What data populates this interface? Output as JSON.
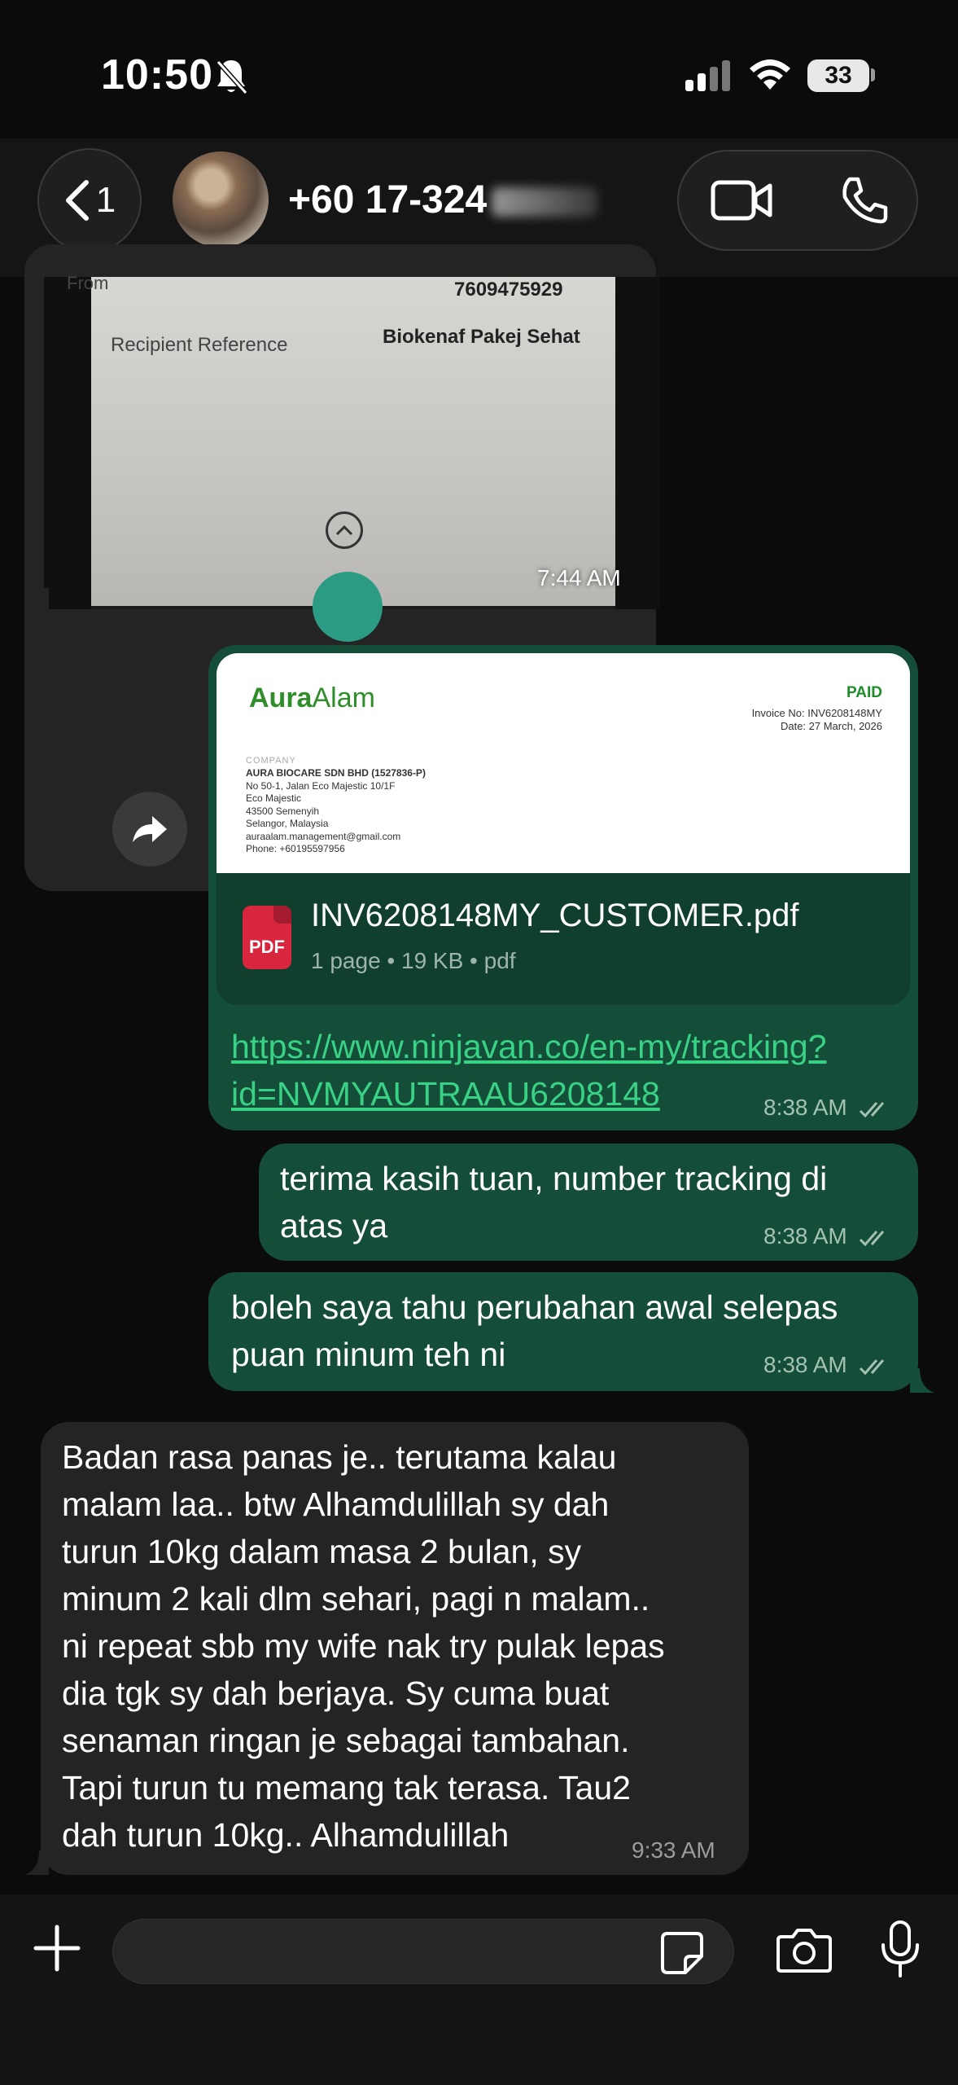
{
  "status_bar": {
    "time": "10:50",
    "battery": "33"
  },
  "header": {
    "back_count": "1",
    "contact_name": "+60 17-324"
  },
  "messages": {
    "image": {
      "photo_from_label": "From",
      "photo_number": "7609475929",
      "photo_ref_label": "Recipient Reference",
      "photo_ref_value": "Biokenaf Pakej Sehat",
      "time": "7:44 AM"
    },
    "invoice": {
      "logo_bold": "Aura",
      "logo_light": "Alam",
      "paid": "PAID",
      "invoice_no": "Invoice No: INV6208148MY",
      "date": "Date: 27 March, 2026",
      "company_label": "COMPANY",
      "company_lines": [
        "AURA BIOCARE SDN BHD (1527836-P)",
        "No 50-1, Jalan Eco Majestic 10/1F",
        "Eco Majestic",
        "43500 Semenyih",
        "Selangor, Malaysia",
        "auraalam.management@gmail.com",
        "Phone: +60195597956"
      ],
      "file_icon_label": "PDF",
      "file_name": "INV6208148MY_CUSTOMER.pdf",
      "file_meta": "1 page • 19 KB • pdf",
      "link_line1": "https://www.ninjavan.co/en-my/tracking?",
      "link_line2": "id=NVMYAUTRAAU6208148",
      "time": "8:38 AM"
    },
    "out1": {
      "line1": "terima kasih tuan, number tracking di",
      "line2": "atas ya",
      "time": "8:38 AM"
    },
    "out2": {
      "line1": "boleh saya tahu perubahan awal selepas",
      "line2": "puan minum teh ni",
      "time": "8:38 AM"
    },
    "in1": {
      "lines": [
        "Badan rasa panas je.. terutama kalau",
        "malam laa.. btw Alhamdulillah sy dah",
        "turun 10kg dalam masa 2 bulan, sy",
        "minum 2 kali dlm sehari, pagi n malam..",
        "ni repeat sbb my wife nak try pulak lepas",
        "dia tgk sy dah berjaya. Sy cuma buat",
        "senaman ringan je sebagai tambahan.",
        "Tapi turun tu memang tak terasa. Tau2",
        "dah turun 10kg.. Alhamdulillah"
      ],
      "time": "9:33 AM"
    }
  },
  "icons": {
    "back": "chevron-left-icon",
    "video": "video-camera-icon",
    "phone": "phone-icon",
    "forward": "forward-arrow-icon",
    "plus": "plus-icon",
    "sticker": "sticker-icon",
    "camera": "camera-icon",
    "mic": "microphone-icon"
  },
  "colors": {
    "outgoing_bubble": "#144d38",
    "incoming_bubble": "#242424",
    "link": "#39d185",
    "background": "#0b0b0b"
  }
}
